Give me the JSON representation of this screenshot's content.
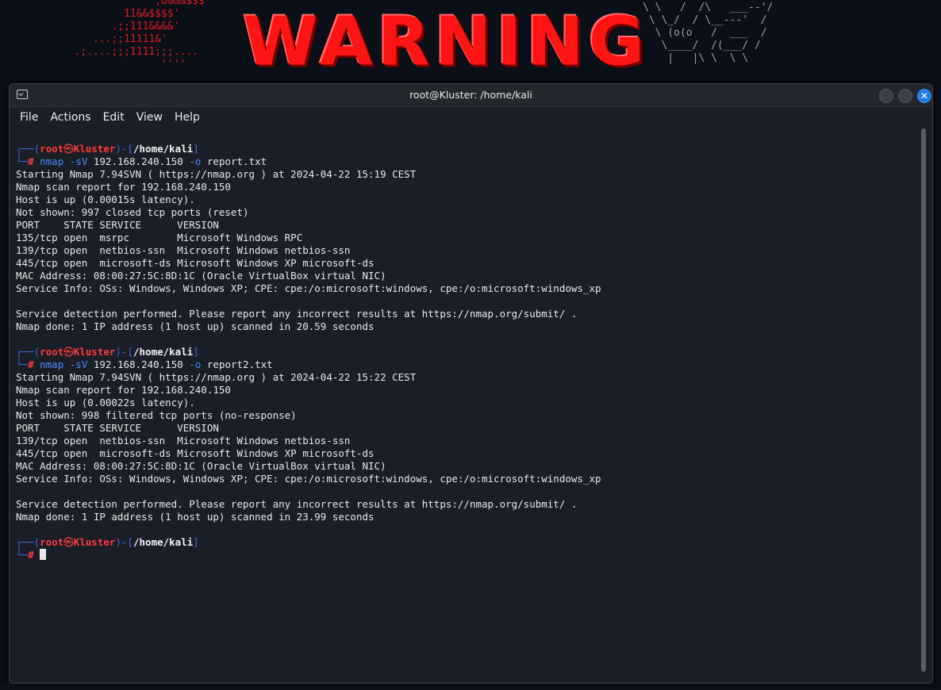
{
  "wallpaper": {
    "banner_text": "WARNING",
    "ascii_top_left": "                ,d&&&$$$'\n           11&&$$$$'\n         .;;111&&&&'\n      ...;;11111&'\n   .;....;;;1111;;;....\n                 ''''",
    "ascii_top_right": "\\ \\   /  /\\   ___--'/\n \\ \\_/  / \\__---'  /\n  \\ (o(o   /  ___  /\n   \\____/  /(___/ /\n    |   |\\ \\  \\ \\"
  },
  "window": {
    "title": "root@Kluster: /home/kali",
    "close_glyph": "✕"
  },
  "menu": [
    "File",
    "Actions",
    "Edit",
    "View",
    "Help"
  ],
  "prompt": {
    "open": "┌──(",
    "user": "root",
    "skull": "㉿",
    "host": "Kluster",
    "mid": ")-[",
    "path": "/home/kali",
    "close": "]",
    "arrow": "└─",
    "hash": "#"
  },
  "sessions": [
    {
      "cmd": "nmap",
      "flag_sv": "-sV",
      "target": "192.168.240.150",
      "flag_o": "-o",
      "outfile": "report.txt",
      "output": [
        "Starting Nmap 7.94SVN ( https://nmap.org ) at 2024-04-22 15:19 CEST",
        "Nmap scan report for 192.168.240.150",
        "Host is up (0.00015s latency).",
        "Not shown: 997 closed tcp ports (reset)",
        "PORT    STATE SERVICE      VERSION",
        "135/tcp open  msrpc        Microsoft Windows RPC",
        "139/tcp open  netbios-ssn  Microsoft Windows netbios-ssn",
        "445/tcp open  microsoft-ds Microsoft Windows XP microsoft-ds",
        "MAC Address: 08:00:27:5C:8D:1C (Oracle VirtualBox virtual NIC)",
        "Service Info: OSs: Windows, Windows XP; CPE: cpe:/o:microsoft:windows, cpe:/o:microsoft:windows_xp",
        "",
        "Service detection performed. Please report any incorrect results at https://nmap.org/submit/ .",
        "Nmap done: 1 IP address (1 host up) scanned in 20.59 seconds",
        ""
      ]
    },
    {
      "cmd": "nmap",
      "flag_sv": "-sV",
      "target": "192.168.240.150",
      "flag_o": "-o",
      "outfile": "report2.txt",
      "output": [
        "Starting Nmap 7.94SVN ( https://nmap.org ) at 2024-04-22 15:22 CEST",
        "Nmap scan report for 192.168.240.150",
        "Host is up (0.00022s latency).",
        "Not shown: 998 filtered tcp ports (no-response)",
        "PORT    STATE SERVICE      VERSION",
        "139/tcp open  netbios-ssn  Microsoft Windows netbios-ssn",
        "445/tcp open  microsoft-ds Microsoft Windows XP microsoft-ds",
        "MAC Address: 08:00:27:5C:8D:1C (Oracle VirtualBox virtual NIC)",
        "Service Info: OSs: Windows, Windows XP; CPE: cpe:/o:microsoft:windows, cpe:/o:microsoft:windows_xp",
        "",
        "Service detection performed. Please report any incorrect results at https://nmap.org/submit/ .",
        "Nmap done: 1 IP address (1 host up) scanned in 23.99 seconds",
        ""
      ]
    }
  ],
  "colors": {
    "prompt_frame": "#4169e1",
    "prompt_user": "#ff3b3b",
    "command": "#4a8cff",
    "close_button": "#1f7de0",
    "warning": "#ff1414"
  }
}
